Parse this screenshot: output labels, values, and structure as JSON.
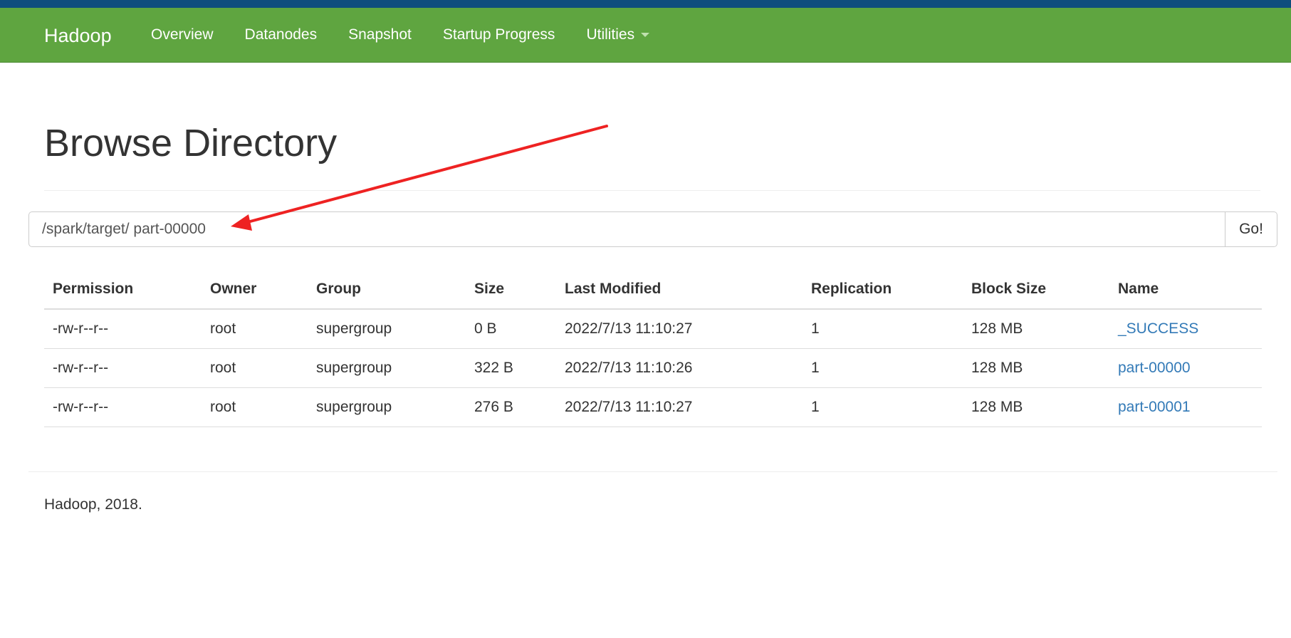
{
  "navbar": {
    "brand": "Hadoop",
    "items": [
      {
        "label": "Overview"
      },
      {
        "label": "Datanodes"
      },
      {
        "label": "Snapshot"
      },
      {
        "label": "Startup Progress"
      },
      {
        "label": "Utilities"
      }
    ]
  },
  "main": {
    "title": "Browse Directory",
    "path_value": "/spark/target/ part-00000",
    "go_label": "Go!"
  },
  "table": {
    "headers": [
      "Permission",
      "Owner",
      "Group",
      "Size",
      "Last Modified",
      "Replication",
      "Block Size",
      "Name"
    ],
    "rows": [
      {
        "permission": "-rw-r--r--",
        "owner": "root",
        "group": "supergroup",
        "size": "0 B",
        "modified": "2022/7/13 11:10:27",
        "replication": "1",
        "block_size": "128 MB",
        "name": "_SUCCESS"
      },
      {
        "permission": "-rw-r--r--",
        "owner": "root",
        "group": "supergroup",
        "size": "322 B",
        "modified": "2022/7/13 11:10:26",
        "replication": "1",
        "block_size": "128 MB",
        "name": "part-00000"
      },
      {
        "permission": "-rw-r--r--",
        "owner": "root",
        "group": "supergroup",
        "size": "276 B",
        "modified": "2022/7/13 11:10:27",
        "replication": "1",
        "block_size": "128 MB",
        "name": "part-00001"
      }
    ]
  },
  "footer": {
    "text": "Hadoop, 2018."
  },
  "colors": {
    "navbar": "#5fa540",
    "top_strip": "#0f4d7d",
    "link": "#337ab7",
    "annotation_arrow": "#ee2222"
  }
}
